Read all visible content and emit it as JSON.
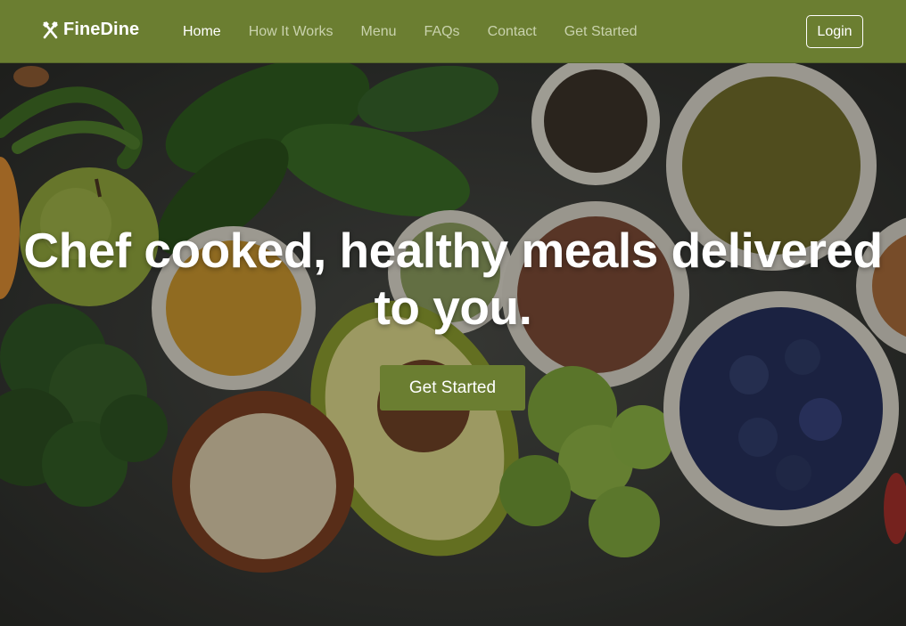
{
  "brand": {
    "name": "FineDine",
    "icon": "fork-knife-icon"
  },
  "nav": {
    "items": [
      {
        "label": "Home",
        "active": true
      },
      {
        "label": "How It Works",
        "active": false
      },
      {
        "label": "Menu",
        "active": false
      },
      {
        "label": "FAQs",
        "active": false
      },
      {
        "label": "Contact",
        "active": false
      },
      {
        "label": "Get Started",
        "active": false
      }
    ],
    "login_label": "Login"
  },
  "hero": {
    "title": "Chef cooked, healthy meals delivered to you.",
    "cta_label": "Get Started",
    "background": "food-bowls-photo"
  },
  "colors": {
    "accent": "#6b7e31",
    "nav_text": "#c9d2ad",
    "nav_text_active": "#ffffff"
  }
}
